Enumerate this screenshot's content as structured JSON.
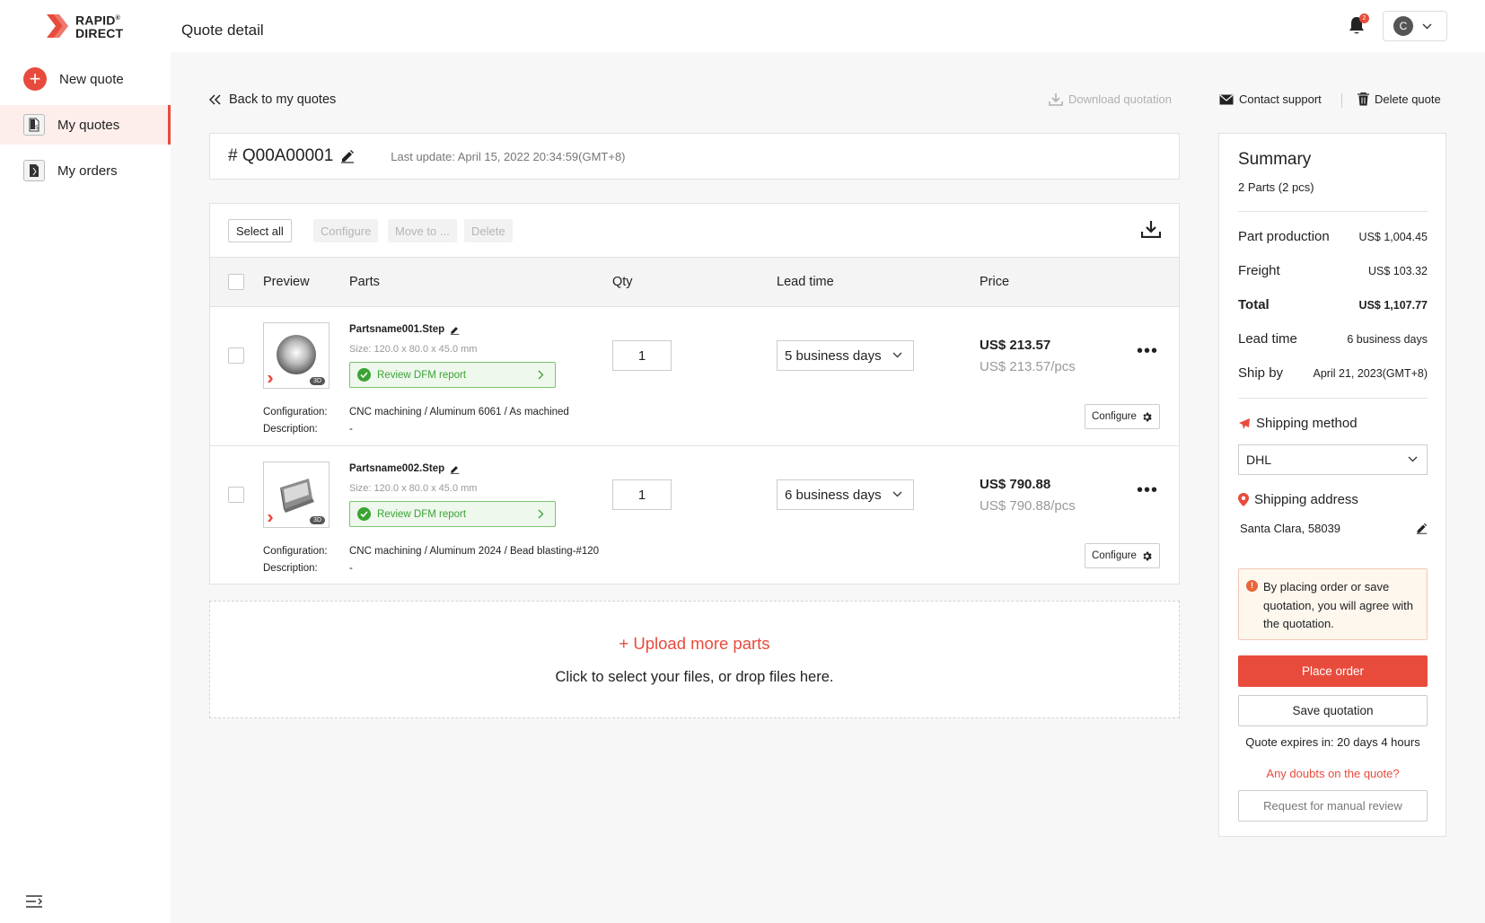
{
  "brand": {
    "line1": "RAPID",
    "line2": "DIRECT",
    "mark": "®",
    "accent": "#e84b3c"
  },
  "sidebar": {
    "items": [
      {
        "label": "New quote"
      },
      {
        "label": "My quotes"
      },
      {
        "label": "My orders"
      }
    ]
  },
  "header": {
    "title": "Quote detail",
    "notification_count": "2",
    "user_initial": "C"
  },
  "actions": {
    "back": "Back to my quotes",
    "download": "Download quotation",
    "contact": "Contact support",
    "delete": "Delete quote"
  },
  "quote": {
    "number": "# Q00A00001",
    "last_update": "Last update: April 15, 2022 20:34:59(GMT+8)"
  },
  "toolbar": {
    "select_all": "Select all",
    "configure": "Configure",
    "move_to": "Move to ...",
    "delete": "Delete"
  },
  "table": {
    "headers": {
      "preview": "Preview",
      "parts": "Parts",
      "qty": "Qty",
      "lead_time": "Lead time",
      "price": "Price"
    },
    "config_label": "Configuration:",
    "desc_label": "Description:",
    "dfm_label": "Review DFM report",
    "configure_label": "Configure",
    "thumb_badge": "3D",
    "rows": [
      {
        "name": "Partsname001.Step",
        "size": "Size: 120.0 x 80.0 x 45.0 mm",
        "configuration": "CNC machining / Aluminum 6061 / As machined",
        "description": "-",
        "qty": "1",
        "lead_time": "5 business days",
        "price": "US$ 213.57",
        "unit_price": "US$ 213.57/pcs"
      },
      {
        "name": "Partsname002.Step",
        "size": "Size: 120.0 x 80.0 x 45.0 mm",
        "configuration": "CNC machining / Aluminum 2024 / Bead blasting-#120",
        "description": "-",
        "qty": "1",
        "lead_time": "6 business days",
        "price": "US$ 790.88",
        "unit_price": "US$ 790.88/pcs"
      }
    ]
  },
  "upload": {
    "title": "+ Upload more parts",
    "subtitle": "Click to select your files, or drop files here."
  },
  "summary": {
    "title": "Summary",
    "parts_count": "2 Parts (2 pcs)",
    "rows": [
      {
        "label": "Part production",
        "value": "US$ 1,004.45"
      },
      {
        "label": "Freight",
        "value": "US$ 103.32"
      },
      {
        "label": "Total",
        "value": "US$ 1,107.77"
      },
      {
        "label": "Lead time",
        "value": "6 business days"
      },
      {
        "label": "Ship by",
        "value": "April 21, 2023(GMT+8)"
      }
    ],
    "shipping_method_title": "Shipping method",
    "shipping_method_value": "DHL",
    "shipping_address_title": "Shipping address",
    "shipping_address_value": "Santa Clara, 58039",
    "notice": "By placing order or save quotation, you will agree with the quotation.",
    "place_order": "Place order",
    "save_quotation": "Save quotation",
    "expires": "Quote expires in: 20 days 4 hours",
    "doubts": "Any doubts on the quote?",
    "manual_review": "Request for manual review"
  }
}
